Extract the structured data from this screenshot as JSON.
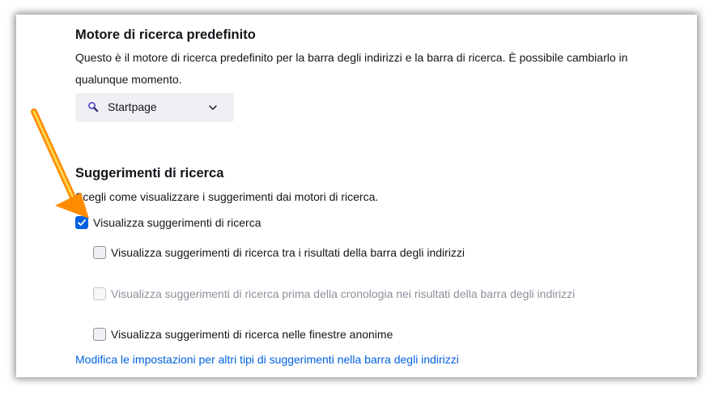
{
  "default_engine": {
    "title": "Motore di ricerca predefinito",
    "description": "Questo è il motore di ricerca predefinito per la barra degli indirizzi e la barra di ricerca. È possibile cambiarlo in qualunque momento.",
    "selected": "Startpage",
    "icon": "startpage-magnifier-icon"
  },
  "suggestions": {
    "title": "Suggerimenti di ricerca",
    "description": "Scegli come visualizzare i suggerimenti dai motori di ricerca.",
    "options": [
      {
        "label": "Visualizza suggerimenti di ricerca",
        "checked": true,
        "disabled": false
      },
      {
        "label": "Visualizza suggerimenti di ricerca tra i risultati della barra degli indirizzi",
        "checked": false,
        "disabled": false
      },
      {
        "label": "Visualizza suggerimenti di ricerca prima della cronologia nei risultati della barra degli indirizzi",
        "checked": false,
        "disabled": true
      },
      {
        "label": "Visualizza suggerimenti di ricerca nelle finestre anonime",
        "checked": false,
        "disabled": false
      }
    ],
    "link": "Modifica le impostazioni per altri tipi di suggerimenti nella barra degli indirizzi"
  },
  "colors": {
    "accent": "#0061e0",
    "arrow": "#ff8c00"
  }
}
